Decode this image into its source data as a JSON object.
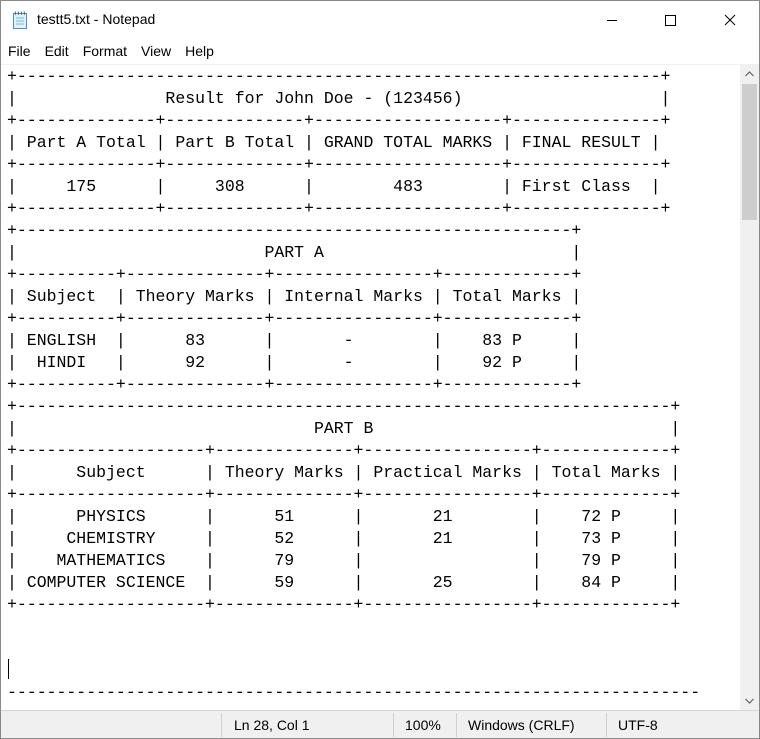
{
  "window": {
    "title": "testt5.txt - Notepad"
  },
  "menu": {
    "items": [
      "File",
      "Edit",
      "Format",
      "View",
      "Help"
    ]
  },
  "editor": {
    "lines": [
      "+-----------------------------------------------------------------+",
      "|               Result for John Doe - (123456)                    |",
      "+--------------+--------------+-------------------+---------------+",
      "| Part A Total | Part B Total | GRAND TOTAL MARKS | FINAL RESULT |",
      "+--------------+--------------+-------------------+---------------+",
      "|     175      |     308      |        483        | First Class  |",
      "+--------------+--------------+-------------------+---------------+",
      "+--------------------------------------------------------+",
      "|                         PART A                         |",
      "+----------+--------------+----------------+-------------+",
      "| Subject  | Theory Marks | Internal Marks | Total Marks |",
      "+----------+--------------+----------------+-------------+",
      "| ENGLISH  |      83      |       -        |    83 P     |",
      "|  HINDI   |      92      |       -        |    92 P     |",
      "+----------+--------------+----------------+-------------+",
      "+------------------------------------------------------------------+",
      "|                              PART B                              |",
      "+-------------------+--------------+-----------------+-------------+",
      "|      Subject      | Theory Marks | Practical Marks | Total Marks |",
      "+-------------------+--------------+-----------------+-------------+",
      "|      PHYSICS      |      51      |       21        |    72 P     |",
      "|     CHEMISTRY     |      52      |       21        |    73 P     |",
      "|    MATHEMATICS    |      79      |                 |    79 P     |",
      "| COMPUTER SCIENCE  |      59      |       25        |    84 P     |",
      "+-------------------+--------------+-----------------+-------------+",
      "",
      "",
      "",
      "----------------------------------------------------------------------"
    ]
  },
  "statusbar": {
    "position": "Ln 28, Col 1",
    "zoom": "100%",
    "line_ending": "Windows (CRLF)",
    "encoding": "UTF-8"
  },
  "colors": {
    "window_bg": "#ffffff",
    "status_bg": "#f0f0f0",
    "scroll_thumb": "#cdcdcd"
  }
}
